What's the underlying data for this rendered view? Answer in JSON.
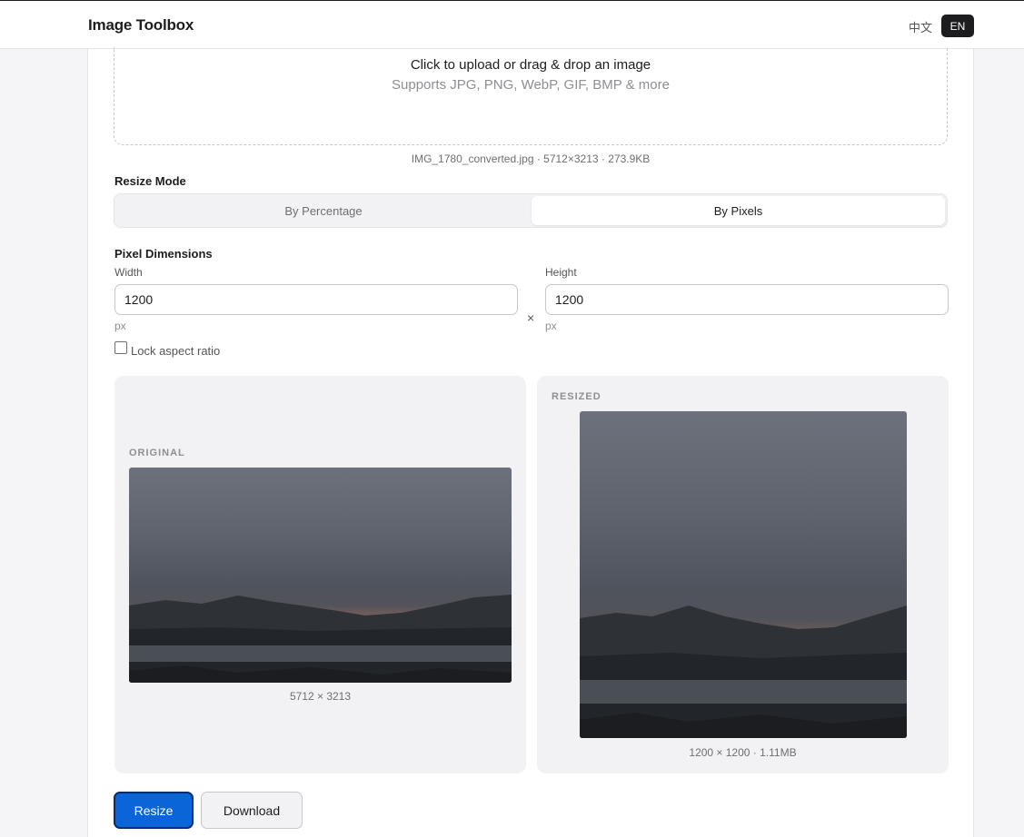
{
  "header": {
    "brand": "Image Toolbox",
    "lang_zh": "中文",
    "lang_en": "EN"
  },
  "upload": {
    "title": "Click to upload or drag & drop an image",
    "subtitle": "Supports JPG, PNG, WebP, GIF, BMP & more",
    "file_info": "IMG_1780_converted.jpg · 5712×3213 · 273.9KB"
  },
  "resize_mode": {
    "label": "Resize Mode",
    "options": [
      "By Percentage",
      "By Pixels"
    ],
    "selected": "By Pixels"
  },
  "pixels": {
    "label": "Pixel Dimensions",
    "width_label": "Width",
    "width_value": "1200",
    "width_unit": "px",
    "height_label": "Height",
    "height_value": "1200",
    "height_unit": "px",
    "separator": "×",
    "lock_label": "Lock aspect ratio",
    "lock_checked": false
  },
  "preview": {
    "original_caption": "ORIGINAL",
    "original_dims": "5712 × 3213",
    "resized_caption": "RESIZED",
    "resized_dims": "1200 × 1200 · 1.11MB"
  },
  "actions": {
    "resize_label": "Resize",
    "download_label": "Download"
  },
  "colors": {
    "primary": "#0a66d8",
    "dark": "#1d1d1f"
  }
}
